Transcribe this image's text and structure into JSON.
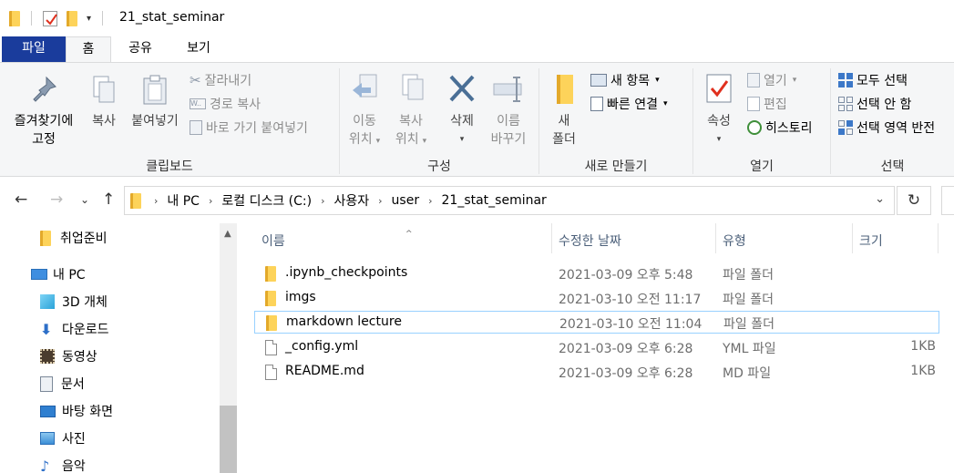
{
  "window": {
    "title": "21_stat_seminar"
  },
  "ribbon_tabs": [
    "파일",
    "홈",
    "공유",
    "보기"
  ],
  "ribbon": {
    "clipboard": {
      "label": "클립보드",
      "pin_line1": "즐겨찾기에",
      "pin_line2": "고정",
      "copy": "복사",
      "paste": "붙여넣기",
      "cut": "잘라내기",
      "copy_path": "경로 복사",
      "paste_shortcut": "바로 가기 붙여넣기"
    },
    "organize": {
      "label": "구성",
      "move_line1": "이동",
      "move_line2": "위치",
      "copyto_line1": "복사",
      "copyto_line2": "위치",
      "delete": "삭제",
      "rename_line1": "이름",
      "rename_line2": "바꾸기"
    },
    "new": {
      "label": "새로 만들기",
      "new_folder_line1": "새",
      "new_folder_line2": "폴더",
      "new_item": "새 항목",
      "easy_access": "빠른 연결"
    },
    "open": {
      "label": "열기",
      "properties": "속성",
      "open": "열기",
      "edit": "편집",
      "history": "히스토리"
    },
    "select": {
      "label": "선택",
      "select_all": "모두 선택",
      "select_none": "선택 안 함",
      "invert": "선택 영역 반전"
    }
  },
  "address": {
    "crumbs": [
      "내 PC",
      "로컬 디스크 (C:)",
      "사용자",
      "user",
      "21_stat_seminar"
    ]
  },
  "nav_pane": {
    "items": [
      {
        "label": "취업준비",
        "icon": "folder-icon"
      },
      {
        "label": "내 PC",
        "icon": "computer-icon"
      },
      {
        "label": "3D 개체",
        "icon": "3d-objects-icon"
      },
      {
        "label": "다운로드",
        "icon": "download-icon"
      },
      {
        "label": "동영상",
        "icon": "video-icon"
      },
      {
        "label": "문서",
        "icon": "document-icon"
      },
      {
        "label": "바탕 화면",
        "icon": "desktop-icon"
      },
      {
        "label": "사진",
        "icon": "pictures-icon"
      },
      {
        "label": "음악",
        "icon": "music-icon"
      }
    ]
  },
  "columns": [
    "이름",
    "수정한 날짜",
    "유형",
    "크기"
  ],
  "files": [
    {
      "name": ".ipynb_checkpoints",
      "date": "2021-03-09 오후 5:48",
      "type": "파일 폴더",
      "size": "",
      "kind": "folder"
    },
    {
      "name": "imgs",
      "date": "2021-03-10 오전 11:17",
      "type": "파일 폴더",
      "size": "",
      "kind": "folder"
    },
    {
      "name": "markdown lecture",
      "date": "2021-03-10 오전 11:04",
      "type": "파일 폴더",
      "size": "",
      "kind": "folder",
      "selected": true
    },
    {
      "name": "_config.yml",
      "date": "2021-03-09 오후 6:28",
      "type": "YML 파일",
      "size": "1KB",
      "kind": "file"
    },
    {
      "name": "README.md",
      "date": "2021-03-09 오후 6:28",
      "type": "MD 파일",
      "size": "1KB",
      "kind": "file"
    }
  ],
  "colors": {
    "file_tab": "#1a3c9c",
    "folder": "#fbcf4e",
    "selection_border": "#99d1ff",
    "header_text": "#4c607a"
  }
}
